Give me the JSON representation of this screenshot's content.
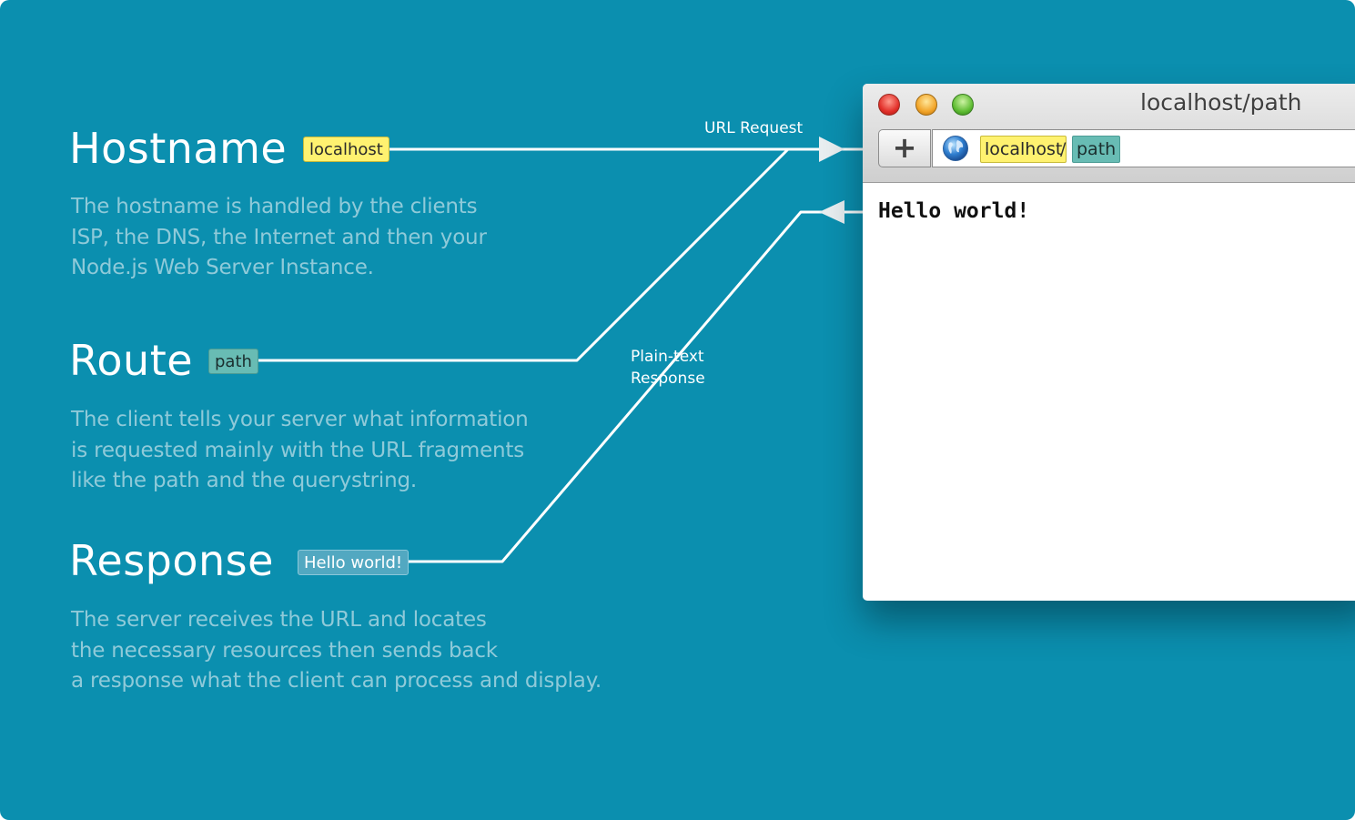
{
  "sections": {
    "hostname": {
      "title": "Hostname",
      "tag": "localhost",
      "desc": [
        "The hostname is handled by the clients",
        "ISP, the DNS, the Internet and then your",
        "Node.js Web Server Instance."
      ]
    },
    "route": {
      "title": "Route",
      "tag": "path",
      "desc": [
        "The client tells your server what information",
        "is requested mainly with the URL fragments",
        "like the path and the querystring."
      ]
    },
    "response": {
      "title": "Response",
      "tag": "Hello world!",
      "desc": [
        "The server receives the URL and locates",
        "the necessary resources then sends back",
        "a response what the client can process and display."
      ]
    }
  },
  "labels": {
    "url_request": "URL Request",
    "plain_text_response": [
      "Plain-text",
      "Response"
    ]
  },
  "browser": {
    "window_title": "localhost/path",
    "add_button": "+",
    "url_host": "localhost",
    "url_separator": "/",
    "url_path": "path",
    "content": "Hello world!",
    "icons": [
      "close-icon",
      "minimize-icon",
      "zoom-icon",
      "plus-icon",
      "globe-icon"
    ]
  },
  "colors": {
    "background": "#0b8faf",
    "hostname_tag": "#fff270",
    "route_tag": "#68bcb4",
    "response_tag": "#52a8c1",
    "description_text": "#8fcad9"
  }
}
